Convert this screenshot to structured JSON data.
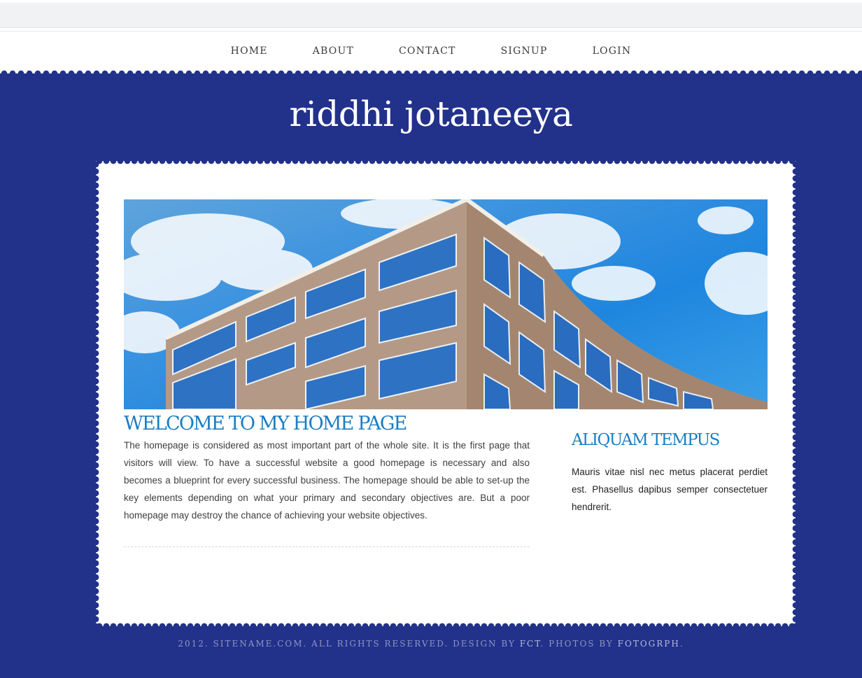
{
  "nav": {
    "items": [
      {
        "label": "HOME"
      },
      {
        "label": "ABOUT"
      },
      {
        "label": "CONTACT"
      },
      {
        "label": "SIGNUP"
      },
      {
        "label": "LOGIN"
      }
    ]
  },
  "header": {
    "site_title": "riddhi jotaneeya"
  },
  "main": {
    "welcome_title": "WELCOME TO MY HOME PAGE",
    "welcome_text": "The homepage is considered as most important part of the whole site. It is the first page that visitors will view. To have a successful website a good homepage is necessary and also becomes a blueprint for every successful business. The homepage should be able to set-up the key elements depending on what your primary and secondary objectives are. But a poor homepage may destroy the chance of achieving your website objectives."
  },
  "sidebar": {
    "title": "ALIQUAM TEMPUS",
    "text": "Mauris vitae nisl nec metus placerat perdiet est. Phasellus dapibus semper consectetuer hendrerit."
  },
  "footer": {
    "prefix": "2012. SITENAME.COM. ALL RIGHTS RESERVED. DESIGN BY ",
    "design_link": "FCT",
    "middle": ". PHOTOS BY ",
    "photos_link": "FOTOGRPH",
    "suffix": "."
  },
  "colors": {
    "background": "#22318a",
    "heading_blue": "#1a7ec4",
    "white": "#ffffff"
  }
}
